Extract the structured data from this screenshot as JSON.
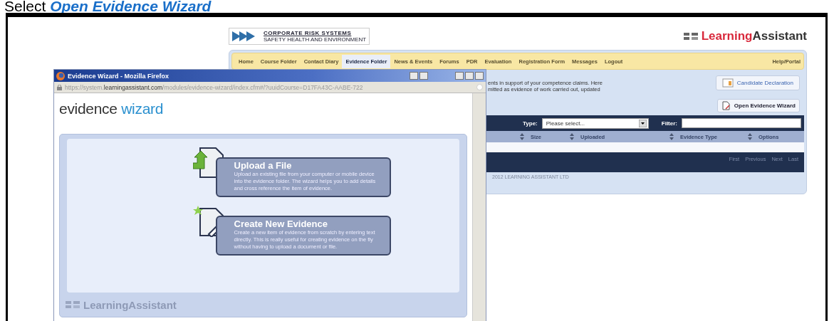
{
  "caption": {
    "prefix": "Select ",
    "emphasis": "Open Evidence Wizard"
  },
  "site": {
    "logo": {
      "title": "CORPORATE RISK SYSTEMS",
      "subtitle": "SAFETY HEALTH AND ENVIRONMENT"
    },
    "brand": {
      "first": "Learning",
      "second": "Assistant"
    },
    "nav": [
      {
        "label": "Home",
        "selected": false
      },
      {
        "label": "Course Folder",
        "selected": false
      },
      {
        "label": "Contact Diary",
        "selected": false
      },
      {
        "label": "Evidence Folder",
        "selected": true
      },
      {
        "label": "News & Events",
        "selected": false
      },
      {
        "label": "Forums",
        "selected": false
      },
      {
        "label": "PDR",
        "selected": false
      },
      {
        "label": "Evaluation",
        "selected": false
      },
      {
        "label": "Registration Form",
        "selected": false
      },
      {
        "label": "Messages",
        "selected": false
      },
      {
        "label": "Logout",
        "selected": false
      }
    ],
    "help_link": "Help/Portal",
    "intro_lines": [
      "ents in support of your competence claims. Here",
      "mitted as evidence of work carried out, updated"
    ],
    "candidate_button": "Candidate Declaration",
    "wizard_button": "Open Evidence Wizard",
    "type_label": "Type:",
    "type_value": "Please select...",
    "filter_label": "Filter:",
    "columns": [
      "Size",
      "Uploaded",
      "Evidence Type",
      "Options"
    ],
    "pager": [
      "First",
      "Previous",
      "Next",
      "Last"
    ],
    "copyright": "2012 LEARNING ASSISTANT LTD"
  },
  "popup": {
    "title": "Evidence Wizard - Mozilla Firefox",
    "url": {
      "before": "https://system.",
      "host": "learningassistant.com",
      "after": "/modules/evidence-wizard/index.cfm#/?uuidCourse=D17FA43C-AABE-722"
    },
    "wizard_logo": {
      "first": "evidence",
      "second": "wizard"
    },
    "options": [
      {
        "kind": "upload",
        "title": "Upload a File",
        "description": "Upload an existing file from your computer or mobile device into the evidence folder. The wizard helps you to add details and cross reference the item of evidence."
      },
      {
        "kind": "create",
        "title": "Create New Evidence",
        "description": "Create a new item of evidence from scratch by entering text directly. This is really useful for creating evidence on the fly without having to upload a document or file."
      }
    ],
    "footer_brand": "LearningAssistant"
  }
}
